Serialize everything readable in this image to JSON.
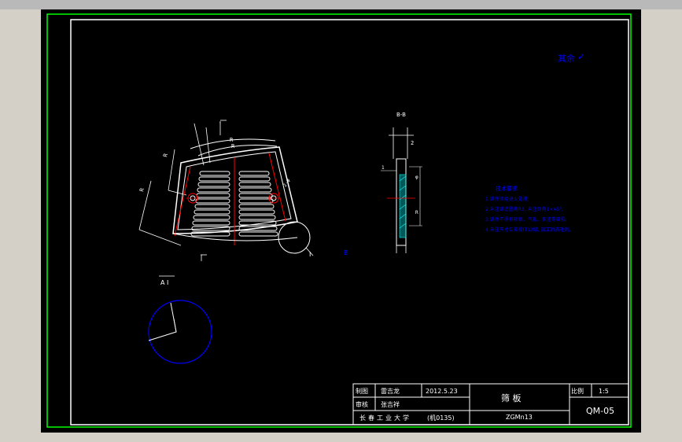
{
  "drawing": {
    "section_label": "B-B",
    "roughness_note": "其余",
    "roughness_symbol": "✓",
    "view_label_a": "A",
    "view_label_one": "I",
    "detail_label": "I",
    "view_label_b": "B",
    "notes": {
      "title": "技术要求",
      "lines": [
        "1.铸件须经退火处理;",
        "2.未注铸造圆角R3, 未注倒角1×45°;",
        "3.铸件不得有砂眼、气孔、夹渣等缺陷;",
        "4.未注尺寸公差按IT12级, 加工后去毛刺。"
      ]
    }
  },
  "title_block": {
    "row1": {
      "role": "制图",
      "name": "雷吉龙",
      "date": "2012.5.23",
      "scale_label": "比例",
      "scale_value": "1:5"
    },
    "row2": {
      "role": "审核",
      "name": "张吉祥"
    },
    "part_name": "筛 板",
    "material": "ZGMn13",
    "school": "长春工业大学",
    "class_code": "(机0135)",
    "drawing_no": "QM-05"
  },
  "colors": {
    "background": "#000000",
    "frame": "#00ff00",
    "blue": "#0000ff",
    "white": "#ffffff",
    "red": "#ff0000",
    "cyan": "#00ffff"
  }
}
